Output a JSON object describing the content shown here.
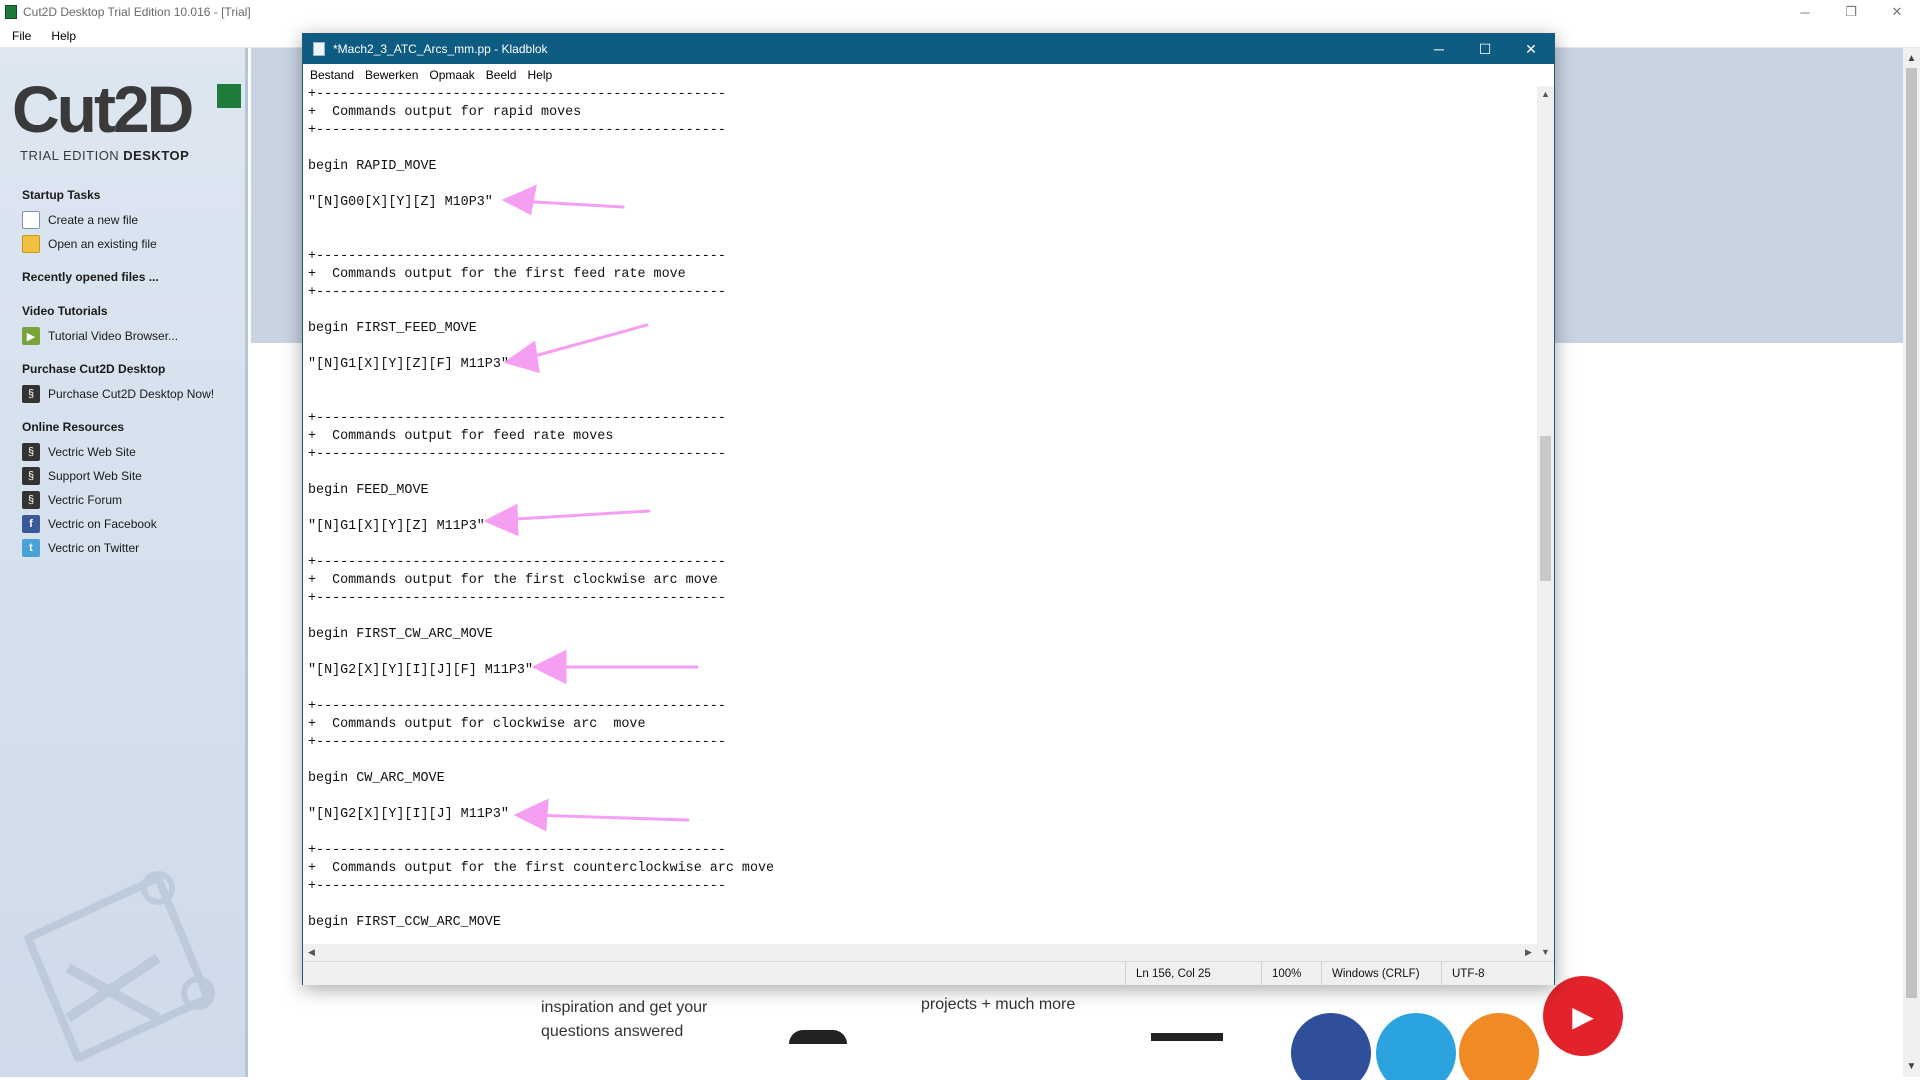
{
  "app": {
    "title": "Cut2D Desktop Trial Edition 10.016 - [Trial]",
    "menu": [
      "File",
      "Help"
    ],
    "controls": {
      "minimize": "─",
      "restore": "❐",
      "close": "✕"
    }
  },
  "brand": {
    "wordmark": "Cut2D",
    "sub": "TRIAL EDITION",
    "sub_bold": "DESKTOP"
  },
  "sidebar": {
    "startup_tasks": "Startup Tasks",
    "create_new": "Create a new file",
    "open_existing": "Open an existing file",
    "recent": "Recently opened files ...",
    "video_tutorials": "Video Tutorials",
    "tutorial_browser": "Tutorial Video Browser...",
    "purchase_heading": "Purchase Cut2D Desktop",
    "purchase_now": "Purchase Cut2D Desktop Now!",
    "online_resources": "Online Resources",
    "vectric_site": "Vectric Web Site",
    "support_site": "Support Web Site",
    "vectric_forum": "Vectric Forum",
    "vectric_facebook": "Vectric on Facebook",
    "vectric_twitter": "Vectric on Twitter"
  },
  "content": {
    "text1_line1": "inspiration and get your",
    "text1_line2": "questions answered",
    "text2": "projects + much more"
  },
  "notepad": {
    "title": "*Mach2_3_ATC_Arcs_mm.pp - Kladblok",
    "menu": [
      "Bestand",
      "Bewerken",
      "Opmaak",
      "Beeld",
      "Help"
    ],
    "lines": [
      "+---------------------------------------------------",
      "+  Commands output for rapid moves",
      "+---------------------------------------------------",
      "",
      "begin RAPID_MOVE",
      "",
      "\"[N]G00[X][Y][Z] M10P3\"",
      "",
      "",
      "+---------------------------------------------------",
      "+  Commands output for the first feed rate move",
      "+---------------------------------------------------",
      "",
      "begin FIRST_FEED_MOVE",
      "",
      "\"[N]G1[X][Y][Z][F] M11P3\"",
      "",
      "",
      "+---------------------------------------------------",
      "+  Commands output for feed rate moves",
      "+---------------------------------------------------",
      "",
      "begin FEED_MOVE",
      "",
      "\"[N]G1[X][Y][Z] M11P3\"",
      "",
      "+---------------------------------------------------",
      "+  Commands output for the first clockwise arc move",
      "+---------------------------------------------------",
      "",
      "begin FIRST_CW_ARC_MOVE",
      "",
      "\"[N]G2[X][Y][I][J][F] M11P3\"",
      "",
      "+---------------------------------------------------",
      "+  Commands output for clockwise arc  move",
      "+---------------------------------------------------",
      "",
      "begin CW_ARC_MOVE",
      "",
      "\"[N]G2[X][Y][I][J] M11P3\"",
      "",
      "+---------------------------------------------------",
      "+  Commands output for the first counterclockwise arc move",
      "+---------------------------------------------------",
      "",
      "begin FIRST_CCW_ARC_MOVE"
    ],
    "status": {
      "position": "Ln 156, Col 25",
      "zoom": "100%",
      "line_endings": "Windows (CRLF)",
      "encoding": "UTF-8"
    }
  },
  "colors": {
    "notepad_titlebar": "#0f5c82",
    "sidebar_bg": "#dde6f1",
    "annotation_arrow": "#f59ff2"
  }
}
